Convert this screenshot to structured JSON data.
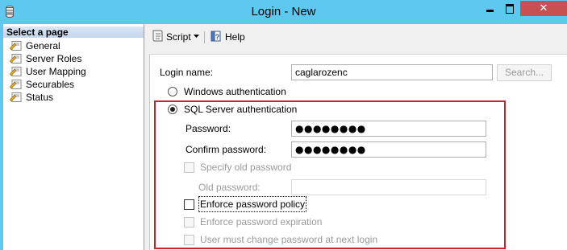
{
  "window": {
    "title": "Login - New",
    "close_glyph": "✕"
  },
  "left_panel": {
    "header": "Select a page",
    "pages": [
      {
        "label": "General",
        "icon": "page-wrench-icon"
      },
      {
        "label": "Server Roles",
        "icon": "page-wrench-icon"
      },
      {
        "label": "User Mapping",
        "icon": "page-wrench-icon"
      },
      {
        "label": "Securables",
        "icon": "page-wrench-icon"
      },
      {
        "label": "Status",
        "icon": "page-wrench-icon"
      }
    ]
  },
  "toolbar": {
    "script_label": "Script",
    "help_label": "Help"
  },
  "form": {
    "login_name_label": "Login name:",
    "login_name_value": "caglarozenc",
    "search_button": "Search...",
    "windows_auth_label": "Windows authentication",
    "sql_auth_label": "SQL Server authentication",
    "auth_selected": "SQL Server authentication",
    "password_label": "Password:",
    "password_value": "●●●●●●●●",
    "confirm_password_label": "Confirm password:",
    "confirm_password_value": "●●●●●●●●",
    "specify_old_password_label": "Specify old password",
    "old_password_label": "Old password:",
    "enforce_policy_label": "Enforce password policy",
    "enforce_expiration_label": "Enforce password expiration",
    "must_change_label": "User must change password at next login"
  },
  "colors": {
    "title_bar": "#5ec8ee",
    "close_button": "#c75050",
    "highlight_box": "#d01f2b"
  }
}
